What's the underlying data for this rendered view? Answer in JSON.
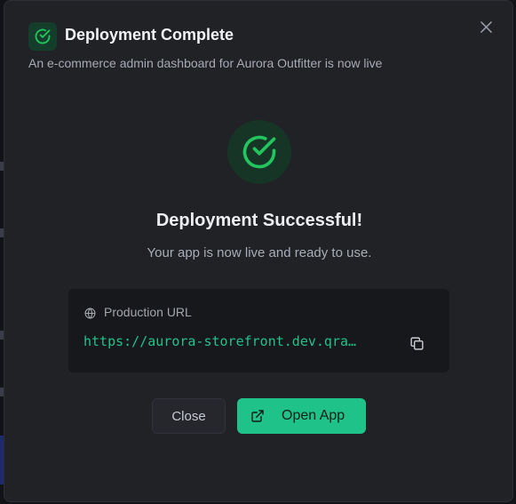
{
  "dialog": {
    "title": "Deployment Complete",
    "subtitle": "An e-commerce admin dashboard for Aurora Outfitter is now live",
    "close_icon": "close-icon",
    "header_icon": "check-circle-icon"
  },
  "status": {
    "icon": "check-circle-icon",
    "heading": "Deployment Successful!",
    "message": "Your app is now live and ready to use."
  },
  "production": {
    "label": "Production URL",
    "label_icon": "globe-icon",
    "url": "https://aurora-storefront.dev.qra…",
    "copy_icon": "copy-icon"
  },
  "actions": {
    "close_label": "Close",
    "open_label": "Open App",
    "open_icon": "external-link-icon"
  },
  "colors": {
    "accent": "#1fc38a",
    "success_green": "#22c55e",
    "surface": "#202226",
    "url_box": "#16181b"
  }
}
